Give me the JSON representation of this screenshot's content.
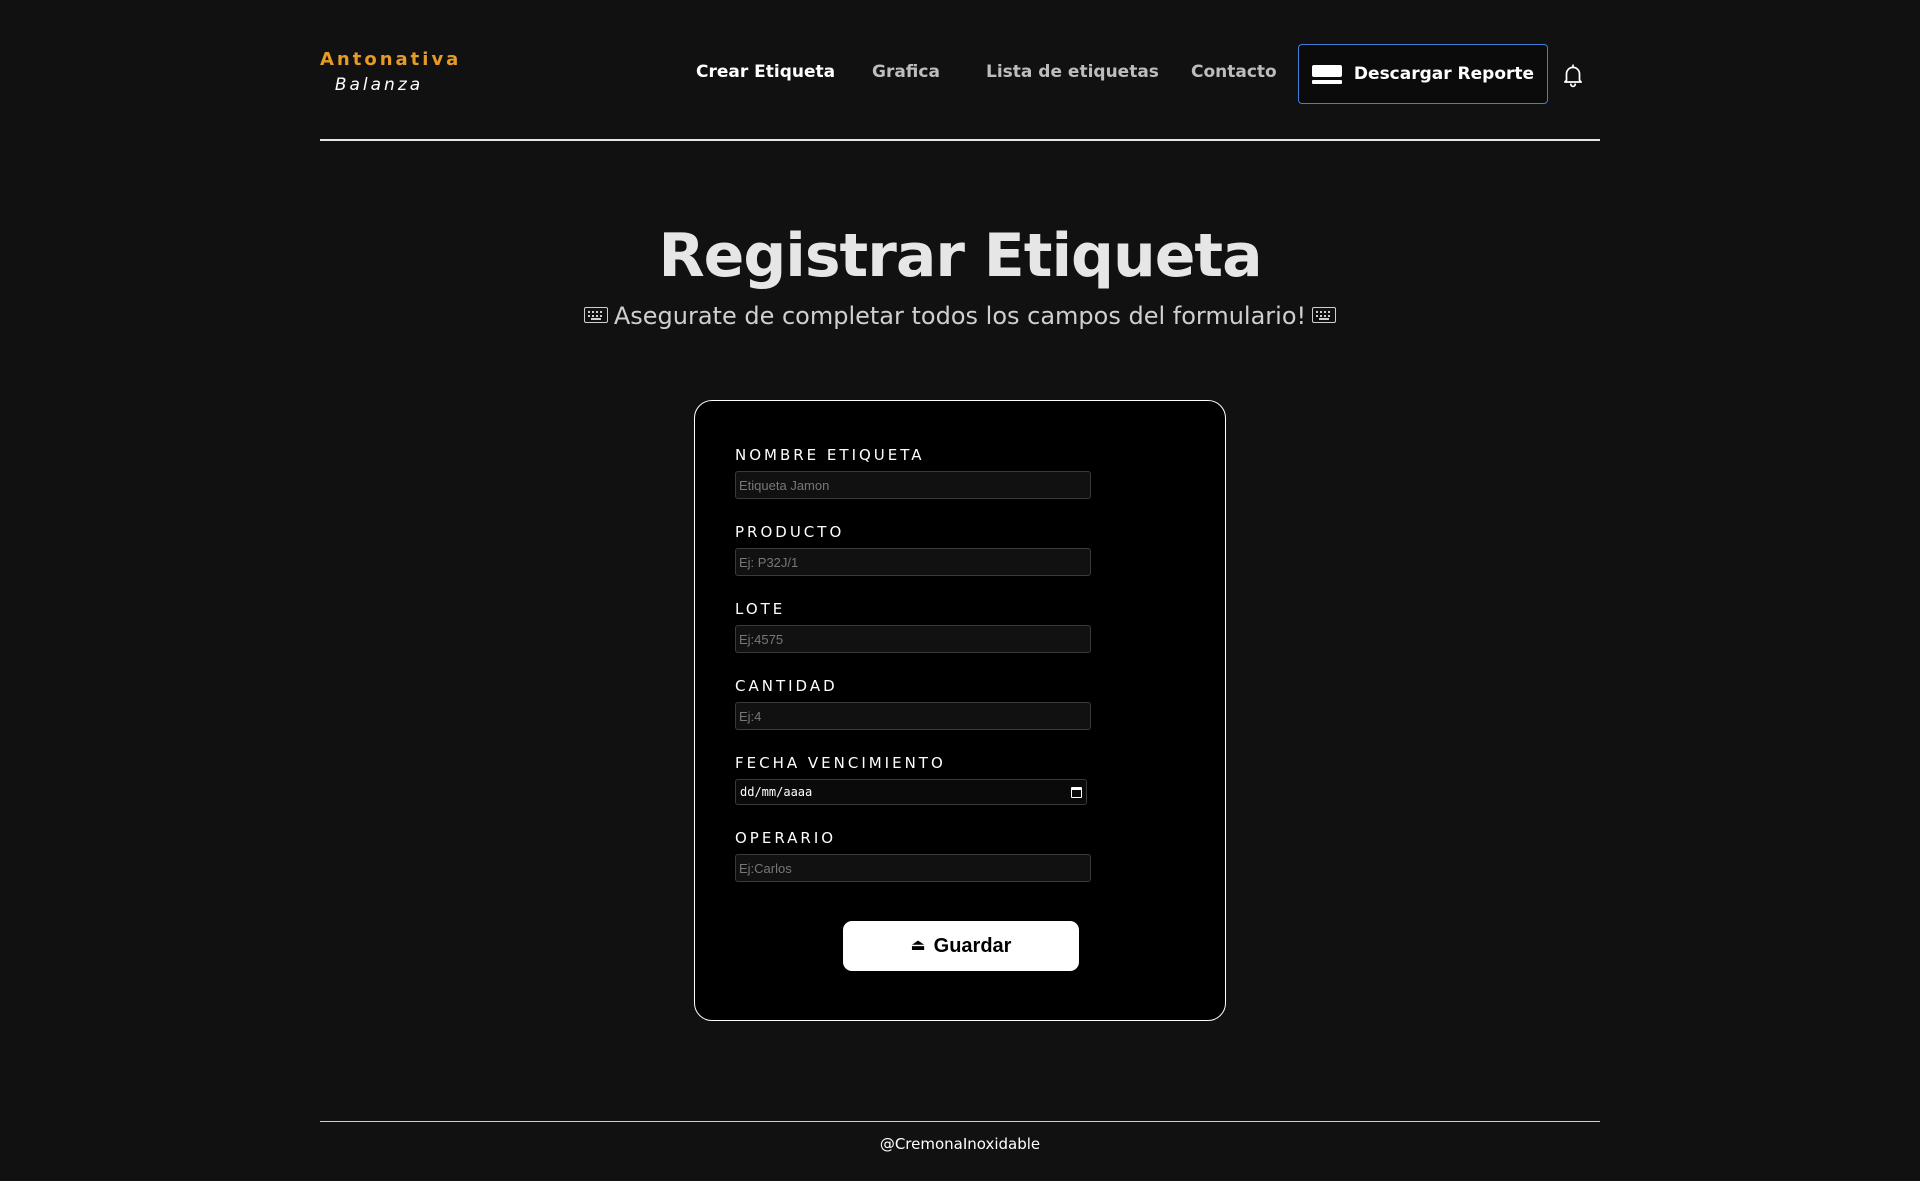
{
  "brand": {
    "name": "Antonativa",
    "subtitle": "Balanza",
    "accent_color": "#e79a26"
  },
  "nav": {
    "items": [
      {
        "label": "Crear Etiqueta",
        "active": true
      },
      {
        "label": "Grafica",
        "active": false
      },
      {
        "label": "Lista de etiquetas",
        "active": false
      },
      {
        "label": "Contacto",
        "active": false
      }
    ],
    "report_button": {
      "label": "Descargar Reporte",
      "icon": "keyboard-icon",
      "border_color": "#3f7fd8"
    },
    "notifications_icon": "bell-icon"
  },
  "hero": {
    "title": "Registrar Etiqueta",
    "subtitle": "Asegurate de completar todos los campos del formulario!",
    "decor_icon": "keyboard-icon"
  },
  "form": {
    "fields": [
      {
        "label": "NOMBRE ETIQUETA",
        "placeholder": "Etiqueta Jamon",
        "value": ""
      },
      {
        "label": "PRODUCTO",
        "placeholder": "Ej: P32J/1",
        "value": ""
      },
      {
        "label": "LOTE",
        "placeholder": "Ej:4575",
        "value": ""
      },
      {
        "label": "CANTIDAD",
        "placeholder": "Ej:4",
        "value": ""
      },
      {
        "label": "FECHA VENCIMIENTO",
        "placeholder": "dd/mm/aaaa",
        "value": "",
        "icon": "calendar-icon"
      },
      {
        "label": "OPERARIO",
        "placeholder": "Ej:Carlos",
        "value": ""
      }
    ],
    "submit": {
      "label": "Guardar",
      "icon": "eject-icon"
    }
  },
  "footer": {
    "text": "@CremonaInoxidable"
  },
  "colors": {
    "page_background": "#111111",
    "card_background": "#000000",
    "text": "#ffffff",
    "muted_text": "#bdbdbd"
  }
}
